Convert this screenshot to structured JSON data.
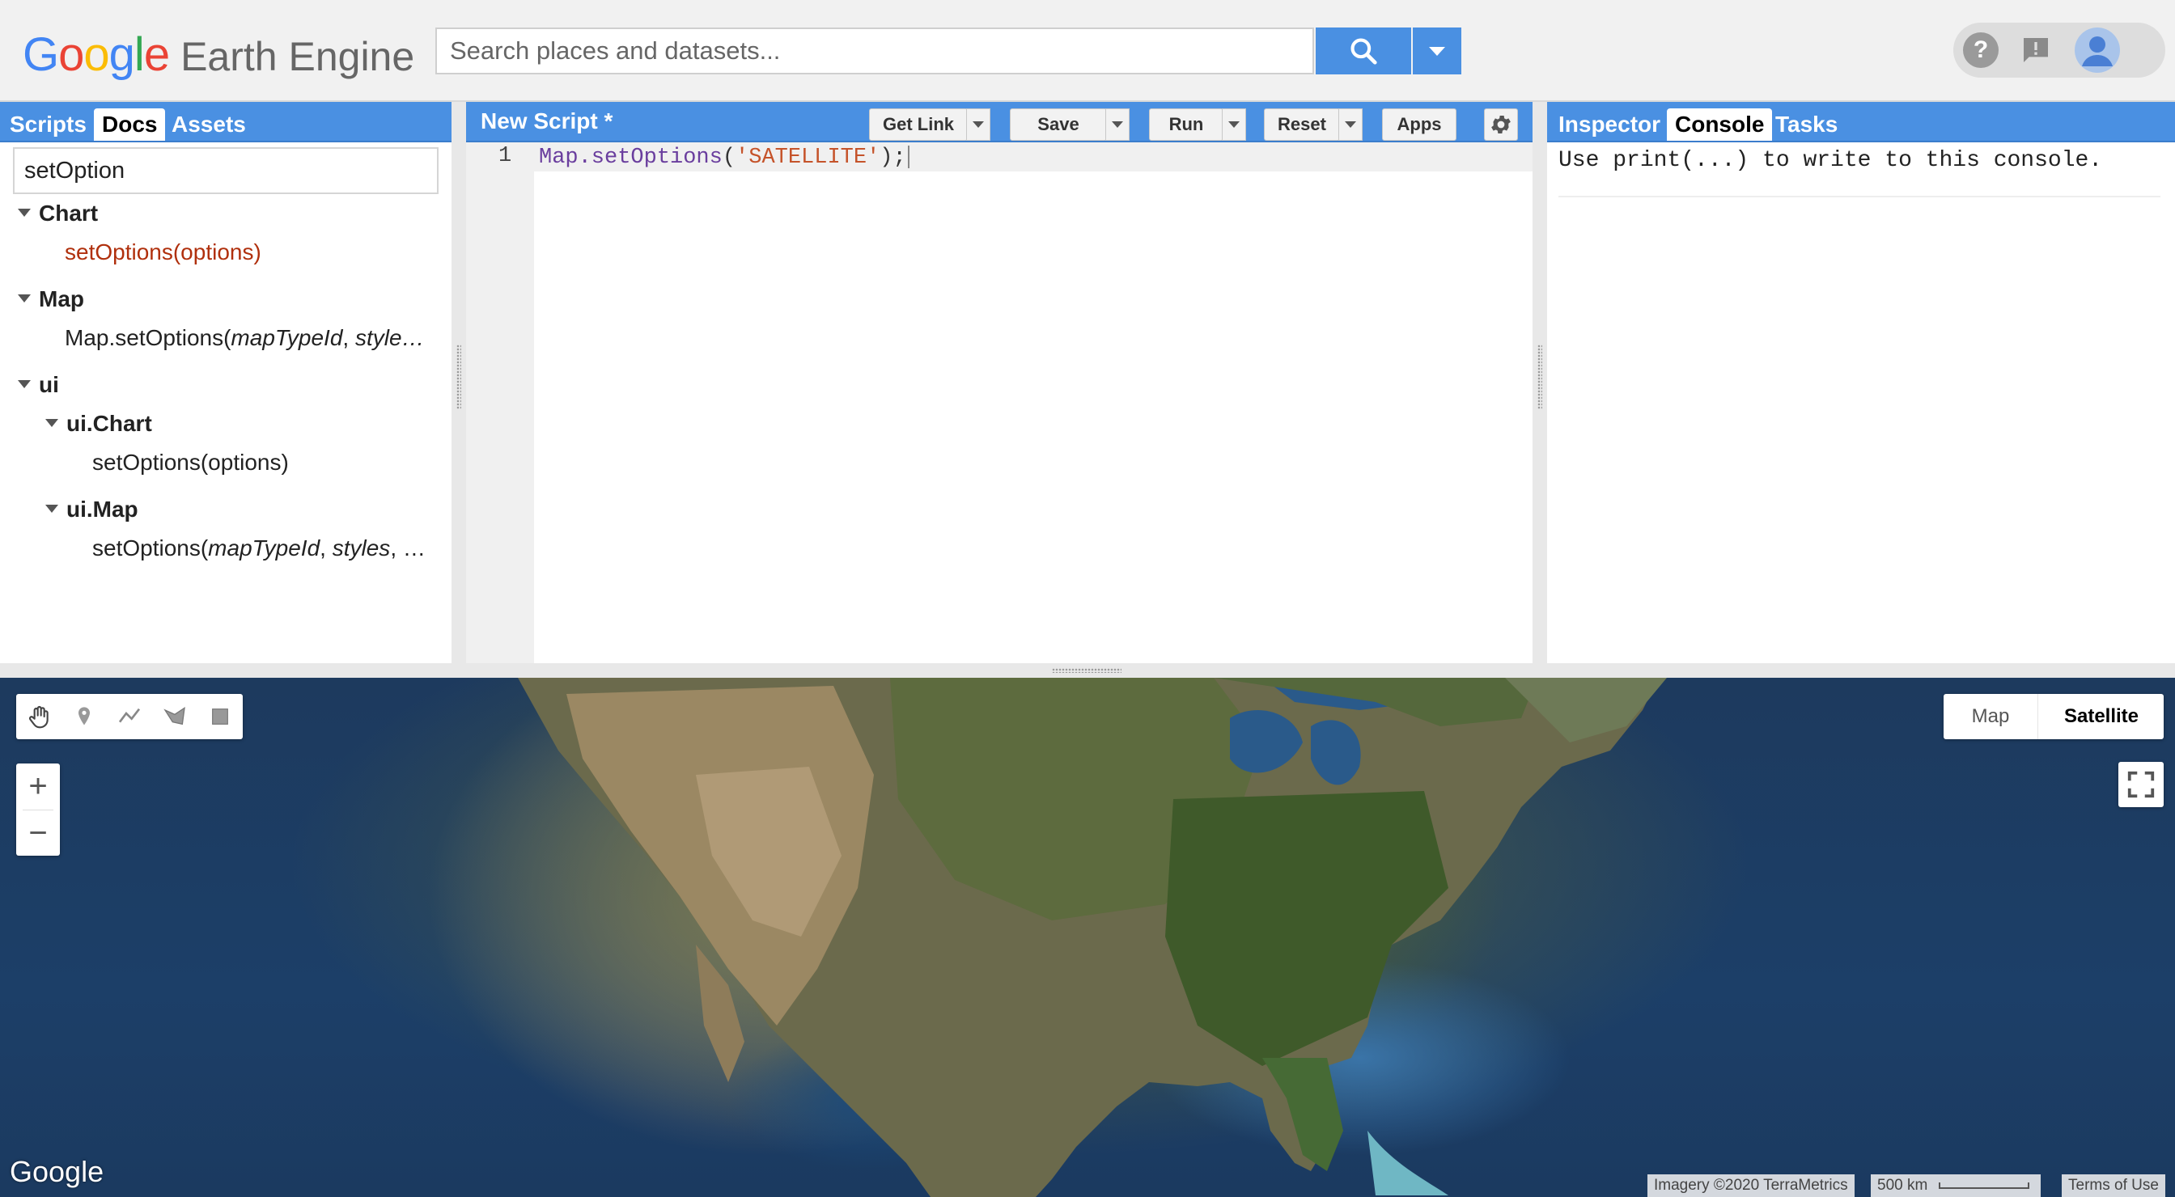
{
  "header": {
    "logo_google": [
      "G",
      "o",
      "o",
      "g",
      "l",
      "e"
    ],
    "logo_product": "Earth Engine",
    "search_placeholder": "Search places and datasets...",
    "search_value": ""
  },
  "left_panel": {
    "tabs": [
      {
        "label": "Scripts",
        "active": false
      },
      {
        "label": "Docs",
        "active": true
      },
      {
        "label": "Assets",
        "active": false
      }
    ],
    "search_value": "setOption",
    "tree": [
      {
        "label": "Chart"
      },
      {
        "label": "setOptions(options)"
      },
      {
        "label": "Map"
      },
      {
        "label_pre": "Map.setOptions(",
        "label_em": "mapTypeId",
        "label_post": ", ",
        "label_em2": "style…"
      },
      {
        "label": "ui"
      },
      {
        "label": "ui.Chart"
      },
      {
        "label": "setOptions(options)"
      },
      {
        "label": "ui.Map"
      },
      {
        "label_pre": "setOptions(",
        "label_em": "mapTypeId",
        "label_post": ", ",
        "label_em2": "styles",
        "label_tail": ", …"
      }
    ]
  },
  "editor": {
    "title": "New Script *",
    "buttons": {
      "get_link": "Get Link",
      "save": "Save",
      "run": "Run",
      "reset": "Reset",
      "apps": "Apps"
    },
    "line_number": "1",
    "code": {
      "obj": "Map.setOptions",
      "open": "(",
      "str": "'SATELLITE'",
      "close": ");"
    }
  },
  "right_panel": {
    "tabs": [
      {
        "label": "Inspector",
        "active": false
      },
      {
        "label": "Console",
        "active": true
      },
      {
        "label": "Tasks",
        "active": false
      }
    ],
    "console_text": "Use print(...) to write to this console."
  },
  "map": {
    "map_type_options": [
      {
        "label": "Map",
        "selected": false
      },
      {
        "label": "Satellite",
        "selected": true
      }
    ],
    "zoom_in": "+",
    "zoom_out": "−",
    "watermark": "Google",
    "attribution": "Imagery ©2020 TerraMetrics",
    "scale": "500 km",
    "terms": "Terms of Use"
  },
  "colors": {
    "accent": "#4a90e2",
    "code_method": "#6a3e9e",
    "code_string": "#c5532a",
    "doc_match": "#b0300d"
  }
}
